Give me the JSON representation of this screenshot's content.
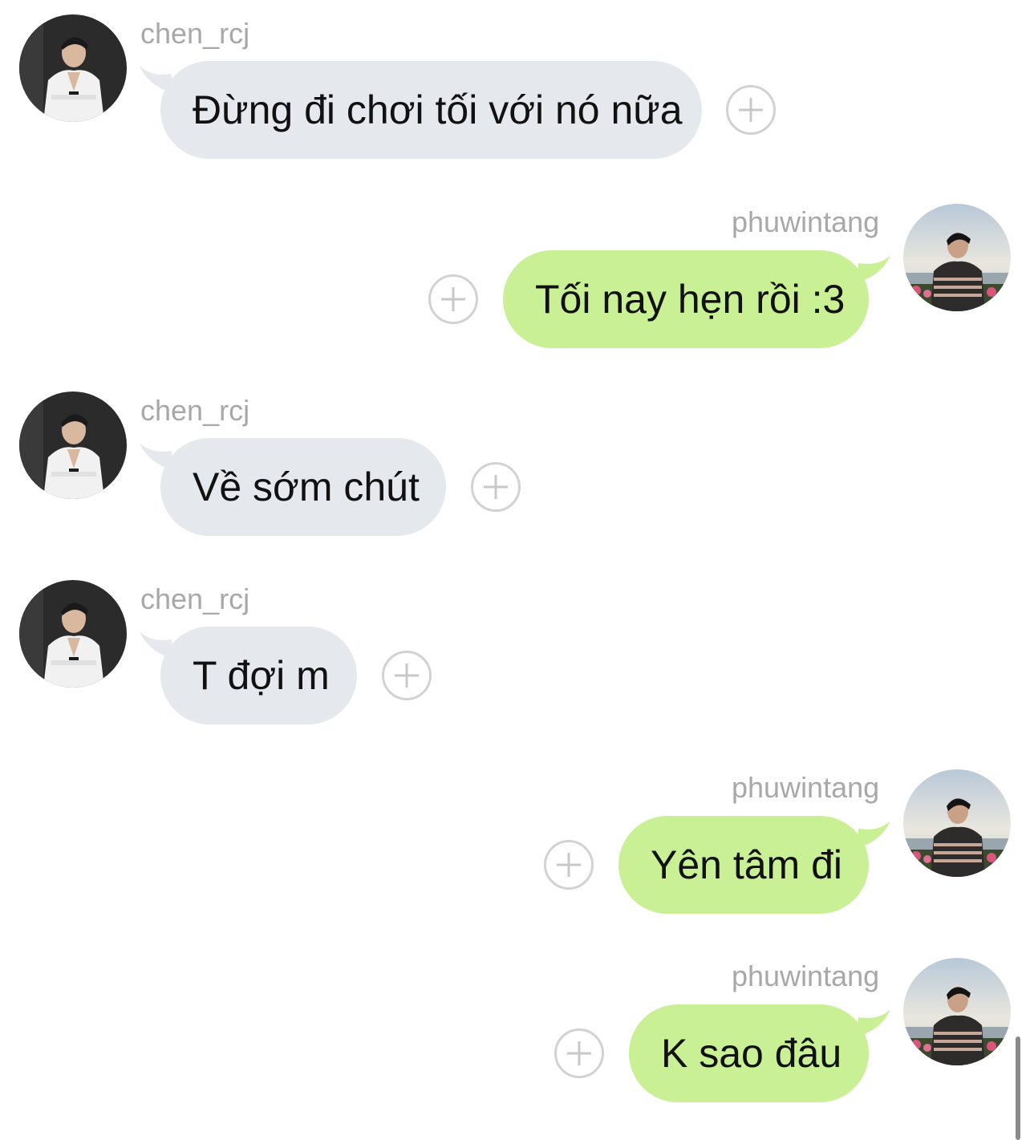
{
  "messages": [
    {
      "sender": "chen_rcj",
      "text": "Đừng đi chơi tối với nó nữa",
      "direction": "incoming"
    },
    {
      "sender": "phuwintang",
      "text": "Tối nay hẹn rồi :3",
      "direction": "outgoing"
    },
    {
      "sender": "chen_rcj",
      "text": "Về sớm chút",
      "direction": "incoming"
    },
    {
      "sender": "chen_rcj",
      "text": "T đợi m",
      "direction": "incoming"
    },
    {
      "sender": "phuwintang",
      "text": "Yên tâm đi",
      "direction": "outgoing"
    },
    {
      "sender": "phuwintang",
      "text": "K sao đâu",
      "direction": "outgoing"
    }
  ],
  "icons": {
    "add_reaction": "plus-circle-icon",
    "avatar_incoming": "person-photo-avatar",
    "avatar_outgoing": "person-photo-avatar"
  },
  "colors": {
    "incoming_bubble": "#e5e8ec",
    "outgoing_bubble": "#c9f095",
    "sender_name": "#a8a8a8",
    "message_text": "#111111"
  }
}
